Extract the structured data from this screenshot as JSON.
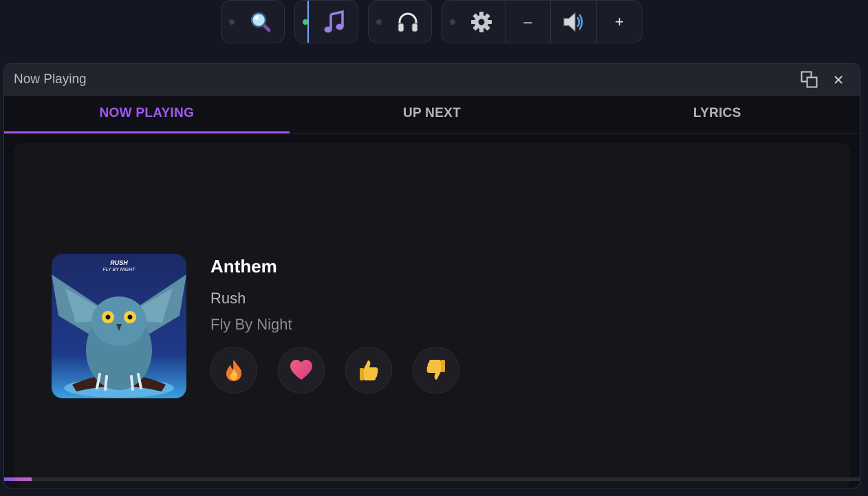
{
  "toolbar": {
    "groups": [
      {
        "items": [
          {
            "icon": "search-icon",
            "indicator": "off"
          }
        ]
      },
      {
        "items": [
          {
            "icon": "music-note-icon",
            "indicator": "on",
            "active": true
          }
        ]
      },
      {
        "items": [
          {
            "icon": "headphones-icon",
            "indicator": "off"
          }
        ]
      },
      {
        "items": [
          {
            "icon": "gear-icon",
            "indicator": "off"
          },
          {
            "label": "–",
            "icon": "volume-down-button"
          },
          {
            "icon": "speaker-icon"
          },
          {
            "label": "+",
            "icon": "volume-up-button"
          }
        ]
      }
    ],
    "volume_down_label": "–",
    "volume_up_label": "+"
  },
  "window": {
    "title": "Now Playing",
    "tabs": [
      {
        "label": "NOW PLAYING",
        "active": true
      },
      {
        "label": "UP NEXT",
        "active": false
      },
      {
        "label": "LYRICS",
        "active": false
      }
    ]
  },
  "now_playing": {
    "title": "Anthem",
    "artist": "Rush",
    "album": "Fly By Night",
    "album_art_text": {
      "band": "RUSH",
      "album": "FLY BY NIGHT"
    },
    "reactions": [
      {
        "icon": "fire-icon"
      },
      {
        "icon": "heart-icon"
      },
      {
        "icon": "thumbs-up-icon"
      },
      {
        "icon": "thumbs-down-icon"
      }
    ],
    "progress_fraction": 0.032
  },
  "colors": {
    "accent": "#a259ef",
    "indicator_on": "#4cc46b",
    "background": "#141722"
  }
}
